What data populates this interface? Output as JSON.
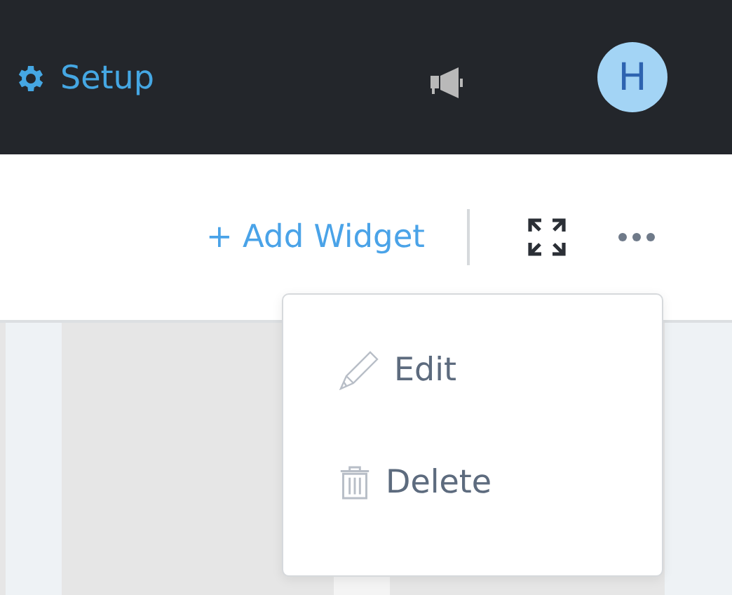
{
  "top_bar": {
    "setup_label": "Setup",
    "avatar_initial": "H"
  },
  "toolbar": {
    "add_widget_label": "+ Add Widget"
  },
  "menu": {
    "items": [
      {
        "kind": "edit",
        "label": "Edit"
      },
      {
        "kind": "delete",
        "label": "Delete"
      }
    ]
  }
}
